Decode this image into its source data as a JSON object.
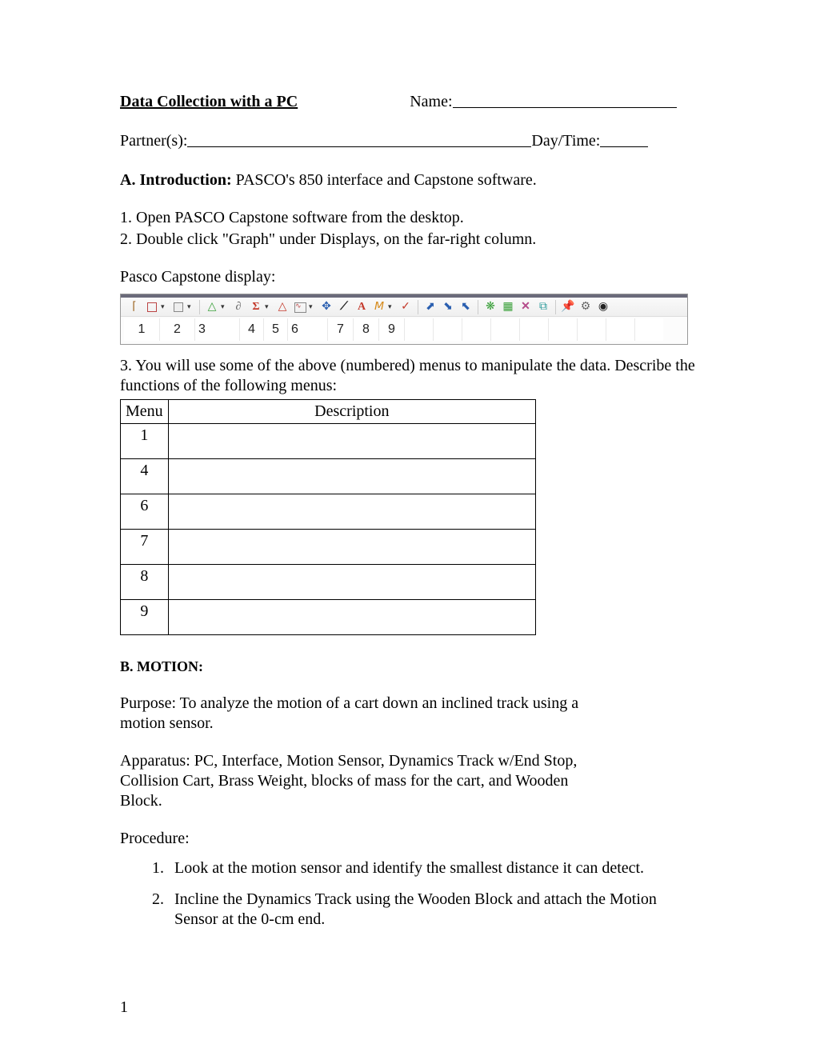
{
  "header": {
    "title": "Data Collection with a PC",
    "name_label": "Name:",
    "partner_label": "Partner(s):",
    "daytime_label": "Day/Time:"
  },
  "intro": {
    "label": "A. Introduction:",
    "text": " PASCO's 850 interface and Capstone software."
  },
  "steps": {
    "s1": "1. Open PASCO Capstone software from the desktop.",
    "s2": "2. Double click \"Graph\" under Displays, on the far-right column."
  },
  "caption": "Pasco Capstone display:",
  "toolbar": {
    "numbers": [
      "1",
      "2",
      "3",
      "4",
      "5",
      "6",
      "7",
      "8",
      "9"
    ]
  },
  "desc_text": "3. You will use some of the above (numbered) menus to manipulate the data. Describe the functions of the following menus:",
  "table": {
    "col1_header": "Menu",
    "col2_header": "Description",
    "rows": [
      "1",
      "4",
      "6",
      "7",
      "8",
      "9"
    ]
  },
  "section_b": {
    "heading": "B. MOTION:",
    "purpose": "Purpose: To analyze the motion of a cart down an inclined track using a motion sensor.",
    "apparatus": "Apparatus: PC, Interface, Motion Sensor, Dynamics Track w/End Stop, Collision Cart, Brass Weight, blocks of mass for the cart, and Wooden Block.",
    "procedure_label": "Procedure:",
    "procedures": [
      "Look at the motion sensor and identify the smallest distance it can detect.",
      "Incline the Dynamics Track using the Wooden Block and attach the Motion Sensor at the 0-cm end."
    ]
  },
  "page_number": "1"
}
